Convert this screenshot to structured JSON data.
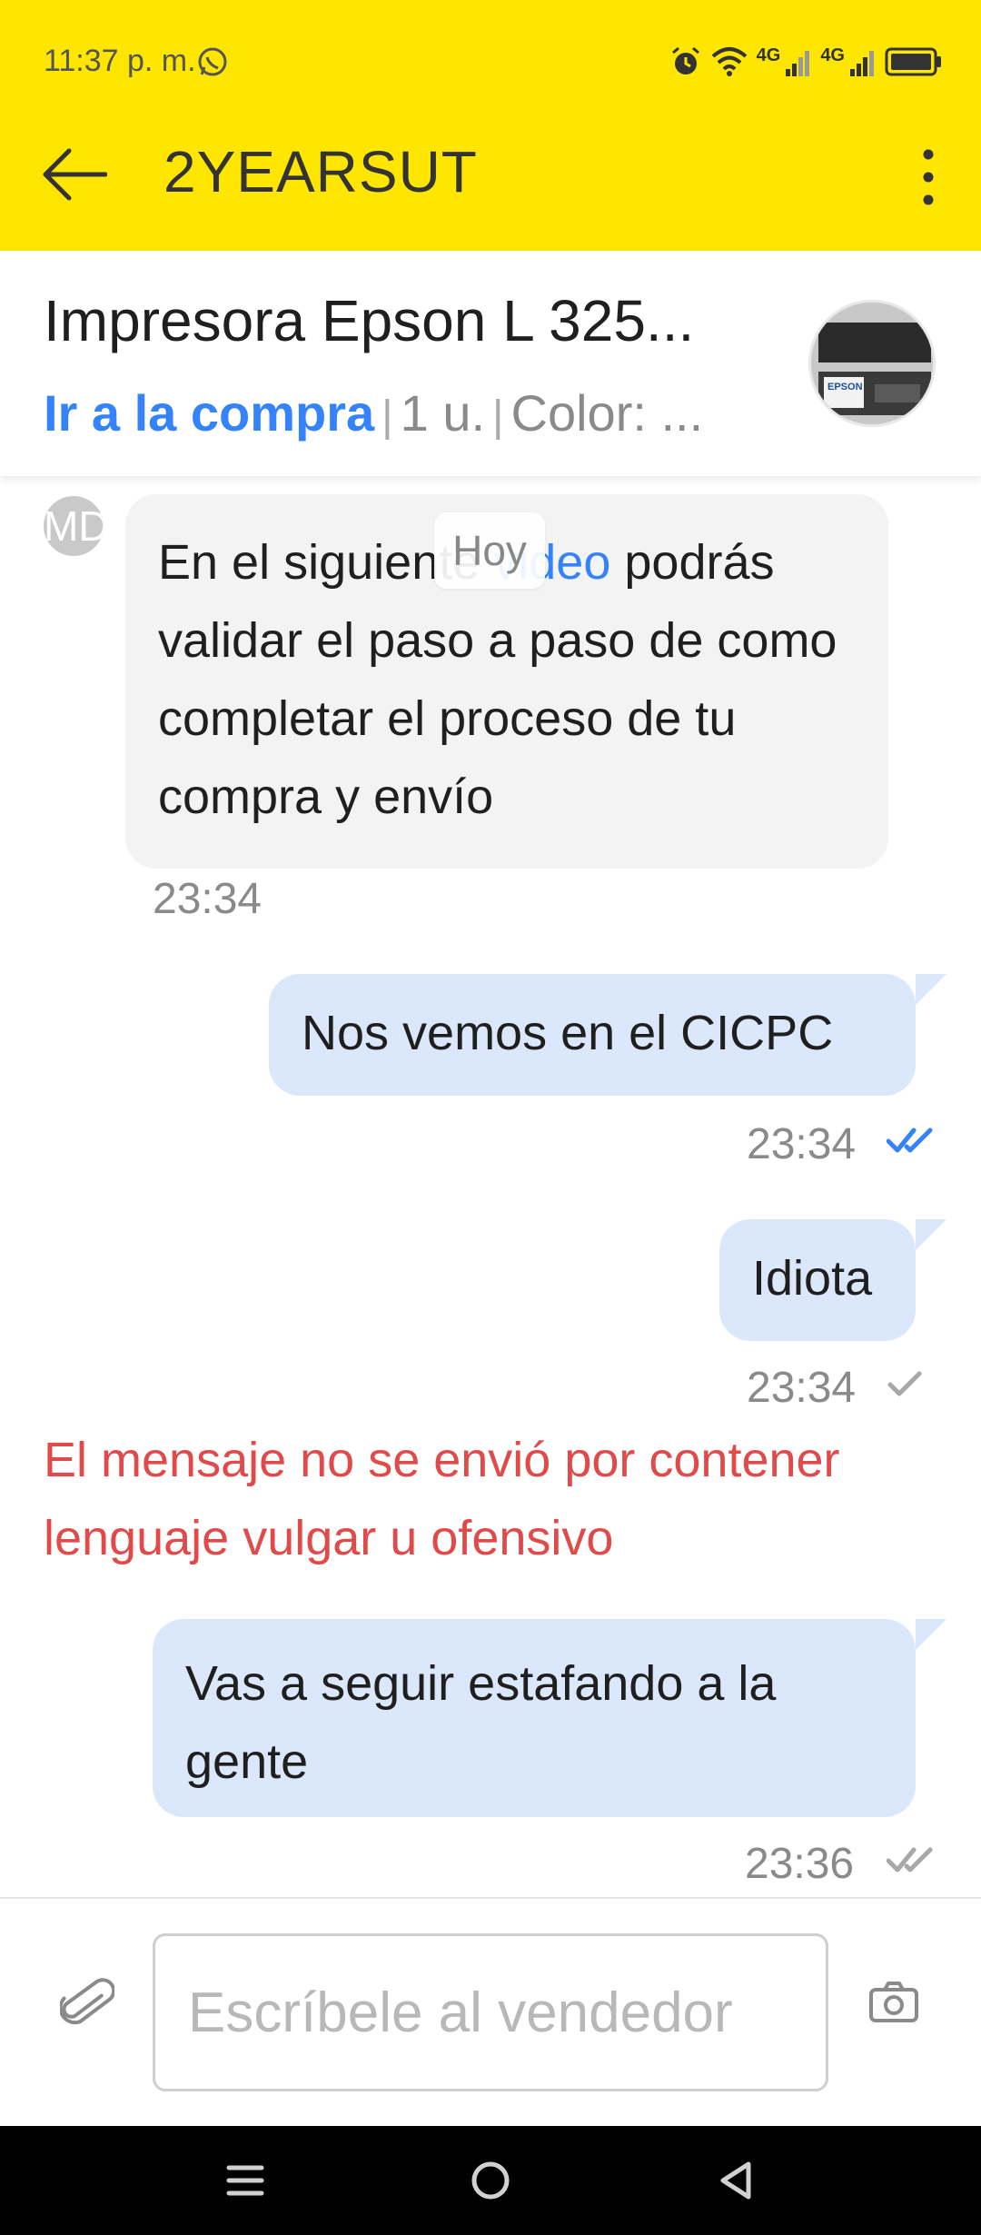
{
  "status_bar": {
    "time": "11:37 p. m.",
    "network_1": "4G",
    "network_2": "4G"
  },
  "app_bar": {
    "title": "2YEARSUT"
  },
  "product": {
    "title": "Impresora Epson L 325...",
    "link": "Ir a la compra",
    "quantity": "1 u.",
    "color": "Color: ...",
    "thumb_label": "EPSON"
  },
  "chat": {
    "avatar_initials": "MD",
    "date_separator": "Hoy",
    "messages": [
      {
        "direction": "in",
        "text_before": "En el siguie",
        "text_hidden": "nte",
        "link_text": "video",
        "text_after": " podrás validar el paso a paso de como completar el proceso de tu compra y envío",
        "time": "23:34"
      },
      {
        "direction": "out",
        "text": "Nos vemos en el CICPC",
        "time": "23:34",
        "status": "read"
      },
      {
        "direction": "out",
        "text": "Idiota",
        "time": "23:34",
        "status": "sent"
      },
      {
        "direction": "out",
        "text": "Vas a seguir estafando a la gente",
        "time": "23:36",
        "status": "delivered"
      }
    ],
    "error_text": "El mensaje no se envió por contener lenguaje vulgar u ofensivo"
  },
  "input": {
    "placeholder": "Escríbele al vendedor"
  },
  "colors": {
    "topbar": "#ffe600",
    "link": "#3483fa",
    "error": "#e04a4a",
    "outgoing_bubble": "#dbe8fb",
    "incoming_bubble": "#f3f3f3"
  },
  "icons": [
    "whatsapp-icon",
    "alarm-icon",
    "wifi-icon",
    "signal-icon",
    "battery-icon",
    "back-arrow-icon",
    "more-vert-icon",
    "double-check-icon",
    "single-check-icon",
    "paperclip-icon",
    "camera-icon",
    "nav-menu-icon",
    "nav-home-icon",
    "nav-back-icon"
  ]
}
